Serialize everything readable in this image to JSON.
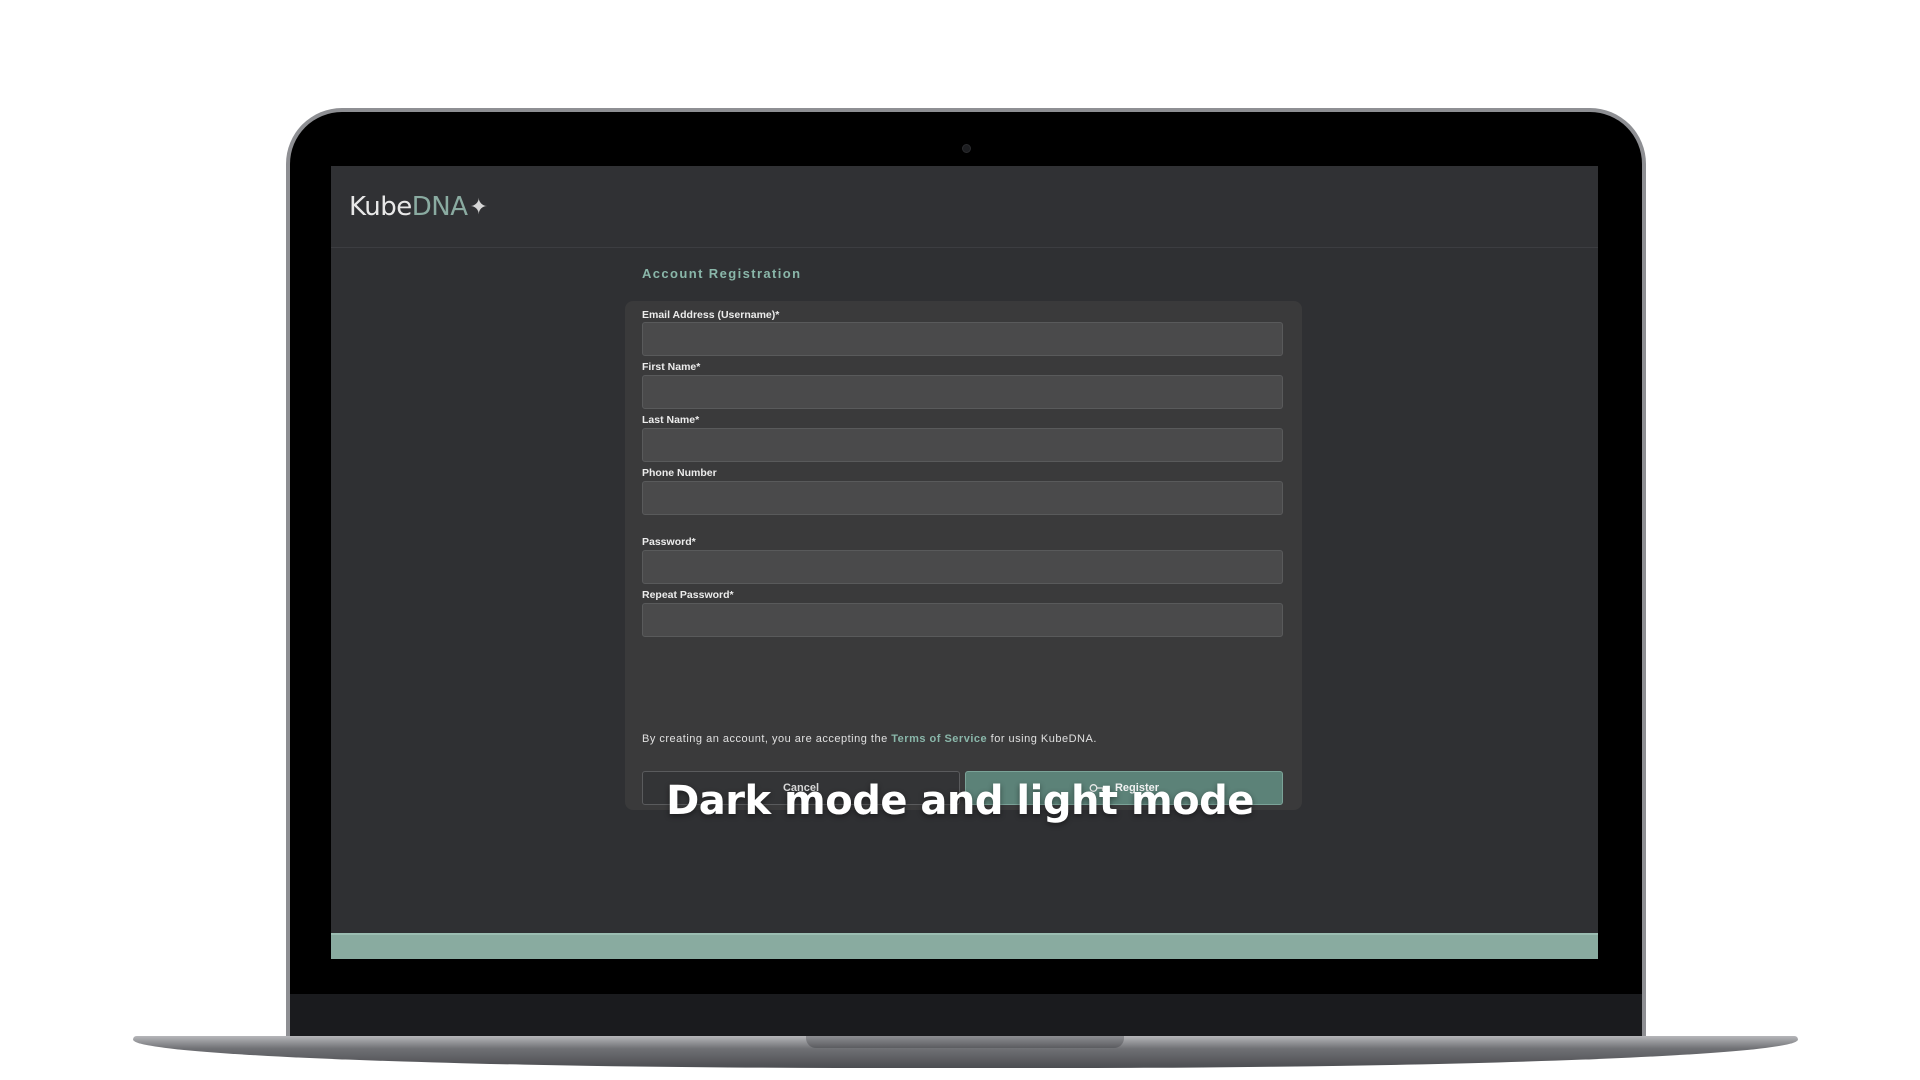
{
  "brand": {
    "name_part1": "Kube",
    "name_part2": "DNA",
    "star": "✦"
  },
  "form": {
    "title": "Account Registration",
    "fields": [
      {
        "label": "Email Address (Username)*",
        "value": "",
        "type": "email"
      },
      {
        "label": "First Name*",
        "value": "",
        "type": "text"
      },
      {
        "label": "Last Name*",
        "value": "",
        "type": "text"
      },
      {
        "label": "Phone Number",
        "value": "",
        "type": "tel"
      },
      {
        "label": "Password*",
        "value": "",
        "type": "password"
      },
      {
        "label": "Repeat Password*",
        "value": "",
        "type": "password"
      }
    ],
    "terms_prefix": "By creating an account, you are accepting the ",
    "terms_link": "Terms of Service",
    "terms_suffix": " for using KubeDNA.",
    "cancel_label": "Cancel",
    "register_label": "Register",
    "register_icon": "key-icon"
  },
  "overlay_caption": "Dark mode and light mode",
  "colors": {
    "accent": "#8ab7aa",
    "register_button": "#5c8278",
    "footer_bar": "#89aba0",
    "background": "#2f3033",
    "card": "#3a3a3b"
  }
}
